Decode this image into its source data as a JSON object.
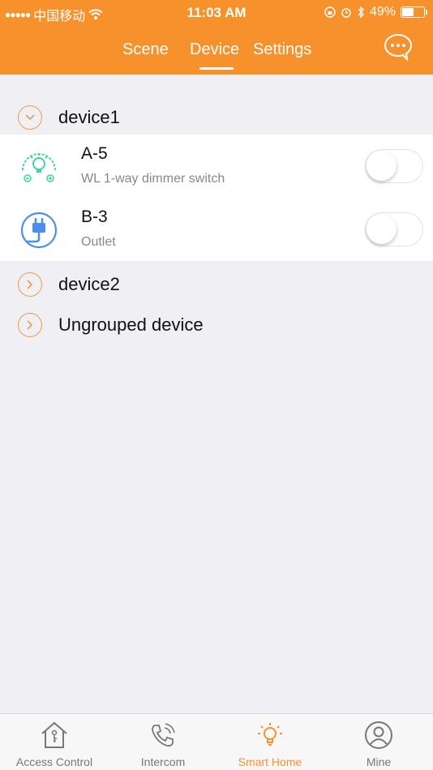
{
  "status_bar": {
    "carrier": "中国移动",
    "time": "11:03 AM",
    "battery": "49%",
    "battery_level": 0.49
  },
  "header": {
    "tabs": [
      {
        "label": "Scene"
      },
      {
        "label": "Device",
        "selected": true
      },
      {
        "label": "Settings"
      }
    ],
    "chat_icon": "chat-bubble-icon"
  },
  "groups": [
    {
      "label": "device1",
      "expanded": true,
      "devices": [
        {
          "name": "A-5",
          "type": "WL 1-way dimmer switch",
          "icon": "dimmer-bulb-icon",
          "on": false
        },
        {
          "name": "B-3",
          "type": "Outlet",
          "icon": "plug-icon",
          "on": false
        }
      ]
    },
    {
      "label": "device2",
      "expanded": false
    },
    {
      "label": "Ungrouped device",
      "expanded": false
    }
  ],
  "bottom_nav": [
    {
      "label": "Access Control",
      "icon": "house-key-icon"
    },
    {
      "label": "Intercom",
      "icon": "phone-icon"
    },
    {
      "label": "Smart Home",
      "icon": "bulb-icon",
      "active": true
    },
    {
      "label": "Mine",
      "icon": "person-icon"
    }
  ],
  "colors": {
    "accent": "#f7912b",
    "chevron": "#f39a4a",
    "dimmer_icon": "#3fd4a6",
    "plug_icon": "#4a8ff0"
  }
}
